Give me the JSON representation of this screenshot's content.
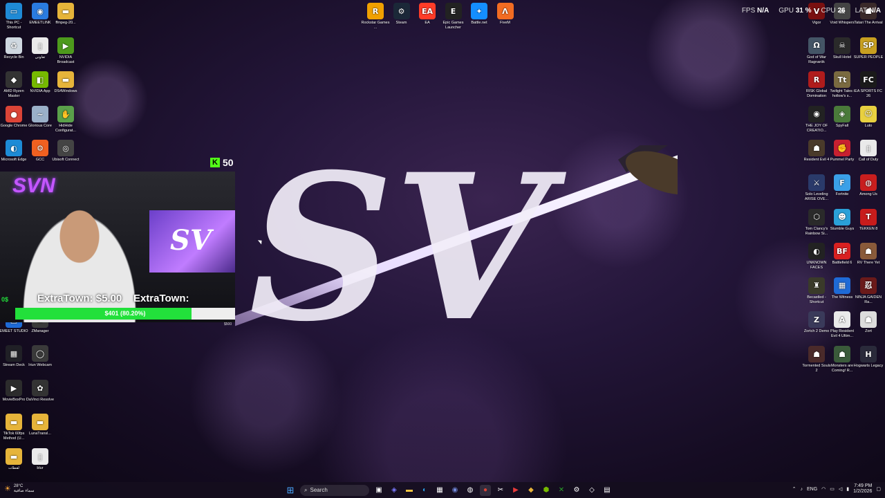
{
  "overlay": {
    "fps_label": "FPS",
    "fps_value": "N/A",
    "gpu_label": "GPU",
    "gpu_value": "31 %",
    "cpu_label": "CPU",
    "cpu_value": "26",
    "lat_label": "LAT",
    "lat_value": "N/A"
  },
  "wallpaper": {
    "logo_text": "SV"
  },
  "left_icons": [
    {
      "label": "This PC - Shortcut",
      "glyph": "▭",
      "color": "#1f8ad6"
    },
    {
      "label": "EMEETLINK",
      "glyph": "◉",
      "color": "#2a7be0"
    },
    {
      "label": "ffmpeg-20...",
      "glyph": "▬",
      "color": "#e6b43a"
    },
    {
      "label": "Recycle Bin",
      "glyph": "♻",
      "color": "#cfd8e0"
    },
    {
      "label": "تعاونی",
      "glyph": "▯",
      "color": "#eaeaea"
    },
    {
      "label": "NVIDIA Broadcast",
      "glyph": "▶",
      "color": "#4d9a1c"
    },
    {
      "label": "AMD Ryzen Master",
      "glyph": "◆",
      "color": "#333333"
    },
    {
      "label": "NVIDIA App",
      "glyph": "◧",
      "color": "#76b900"
    },
    {
      "label": "DS4Windows",
      "glyph": "▬",
      "color": "#e6b43a"
    },
    {
      "label": "Google Chrome",
      "glyph": "●",
      "color": "#db4437"
    },
    {
      "label": "Glorious Core",
      "glyph": "~",
      "color": "#9ab0c8"
    },
    {
      "label": "HidHide Configurat...",
      "glyph": "✋",
      "color": "#5aa04a"
    },
    {
      "label": "Microsoft Edge",
      "glyph": "◐",
      "color": "#1d8bd6"
    },
    {
      "label": "GCC",
      "glyph": "⚙",
      "color": "#f06020"
    },
    {
      "label": "Ubisoft Connect",
      "glyph": "◎",
      "color": "#444444"
    },
    {
      "label": "EMEET STUDIO",
      "glyph": "▣",
      "color": "#1e6ad6"
    },
    {
      "label": "ZManager",
      "glyph": "Z",
      "color": "#3a3a3a"
    },
    {
      "label": "Stream Deck",
      "glyph": "▦",
      "color": "#202026"
    },
    {
      "label": "Iriun Webcam",
      "glyph": "◯",
      "color": "#3a3a3a"
    },
    {
      "label": "MovieBoxPro",
      "glyph": "▶",
      "color": "#2c2c2c"
    },
    {
      "label": "DaVinci Resolve",
      "glyph": "✿",
      "color": "#333333"
    },
    {
      "label": "TikTok 60fps Method (U...",
      "glyph": "▬",
      "color": "#e6b43a"
    },
    {
      "label": "LunaTransl...",
      "glyph": "▬",
      "color": "#e6b43a"
    },
    {
      "label": "لقطات",
      "glyph": "▬",
      "color": "#e6b43a"
    },
    {
      "label": "blur",
      "glyph": "▯",
      "color": "#eaeaea"
    }
  ],
  "top_icons": [
    {
      "label": "Rockstar Games ...",
      "glyph": "R",
      "color": "#f0a000"
    },
    {
      "label": "Steam",
      "glyph": "⚙",
      "color": "#1b2838"
    },
    {
      "label": "EA",
      "glyph": "EA",
      "color": "#ff3c28"
    },
    {
      "label": "Epic Games Launcher",
      "glyph": "E",
      "color": "#222222"
    },
    {
      "label": "Battle.net",
      "glyph": "✦",
      "color": "#148eff"
    },
    {
      "label": "FiveM",
      "glyph": "Λ",
      "color": "#f26c22"
    }
  ],
  "right_icons": [
    {
      "label": "Vigor",
      "glyph": "V",
      "color": "#7a1010"
    },
    {
      "label": "Void Whispers",
      "glyph": "☠",
      "color": "#444444"
    },
    {
      "label": "Tatari The Arrival",
      "glyph": "☗",
      "color": "#3a2a2a"
    },
    {
      "label": "God of War Ragnarök",
      "glyph": "Ω",
      "color": "#445566"
    },
    {
      "label": "Skull Hotel",
      "glyph": "☠",
      "color": "#2a2a2a"
    },
    {
      "label": "SUPER PEOPLE",
      "glyph": "SP",
      "color": "#c8a020"
    },
    {
      "label": "RISK Global Domination",
      "glyph": "R",
      "color": "#b01c1c"
    },
    {
      "label": "Twilight Tales i hollow's s...",
      "glyph": "Tt",
      "color": "#7a6a40"
    },
    {
      "label": "EA SPORTS FC 26",
      "glyph": "FC",
      "color": "#1a1a1a"
    },
    {
      "label": "THE JOY OF CREATIO...",
      "glyph": "◉",
      "color": "#222222"
    },
    {
      "label": "SpyFall",
      "glyph": "◈",
      "color": "#4a7a3a"
    },
    {
      "label": "Luto",
      "glyph": "☺",
      "color": "#e8d040"
    },
    {
      "label": "Resident Evil 4",
      "glyph": "☗",
      "color": "#4a3a2a"
    },
    {
      "label": "Pummel Party",
      "glyph": "✊",
      "color": "#c82030"
    },
    {
      "label": "Call of Duty",
      "glyph": "▯",
      "color": "#eaeaea"
    },
    {
      "label": "Solo Leveling ARISE OVE...",
      "glyph": "⚔",
      "color": "#2a3a6a"
    },
    {
      "label": "Fortnite",
      "glyph": "F",
      "color": "#3aa0e8"
    },
    {
      "label": "Among Us",
      "glyph": "◍",
      "color": "#c81e1e"
    },
    {
      "label": "Tom Clancy's Rainbow Si...",
      "glyph": "⬡",
      "color": "#2a2a2a"
    },
    {
      "label": "Stumble Guys",
      "glyph": "☻",
      "color": "#2aa0d8"
    },
    {
      "label": "TEKKEN 8",
      "glyph": "T",
      "color": "#c81c1c"
    },
    {
      "label": "UNKNOWN FACES",
      "glyph": "◐",
      "color": "#222222"
    },
    {
      "label": "Battlefield 6",
      "glyph": "BF",
      "color": "#d82020"
    },
    {
      "label": "RV There Yet",
      "glyph": "☗",
      "color": "#8a5a3a"
    },
    {
      "label": "Becastled - Shortcut",
      "glyph": "♜",
      "color": "#3a3a2a"
    },
    {
      "label": "The Witness",
      "glyph": "▦",
      "color": "#1e6ad6"
    },
    {
      "label": "NINJA GAIDEN Ra...",
      "glyph": "忍",
      "color": "#6a1a1a"
    },
    {
      "label": "Zortch 2 Demo",
      "glyph": "Z",
      "color": "#3a3a5a"
    },
    {
      "label": "Play Resident Evil 4 Ultim...",
      "glyph": "A",
      "color": "#eaeaea"
    },
    {
      "label": "Zort",
      "glyph": "☗",
      "color": "#dddddd"
    },
    {
      "label": "Tormented Souls 2",
      "glyph": "☗",
      "color": "#4a2a2a"
    },
    {
      "label": "Monsters are Coming! R...",
      "glyph": "☗",
      "color": "#3a5a3a"
    },
    {
      "label": "Hogwarts Legacy",
      "glyph": "H",
      "color": "#2a2a3a"
    }
  ],
  "stream": {
    "kick_count": "50",
    "webcam_neon": "SVN",
    "goal_title_left": "ExtraTown: $5.00",
    "goal_title_right": "ExtraTown:",
    "goal_bar_label": "$401 (80.20%)",
    "goal_progress": 0.802,
    "goal_right_amount": "$500",
    "goal_left_marker": "0$"
  },
  "taskbar": {
    "search_placeholder": "Search",
    "weather_temp": "28°C",
    "weather_desc": "سماء صافية",
    "lang": "ENG",
    "time": "7:49 PM",
    "date": "1/2/2026"
  }
}
